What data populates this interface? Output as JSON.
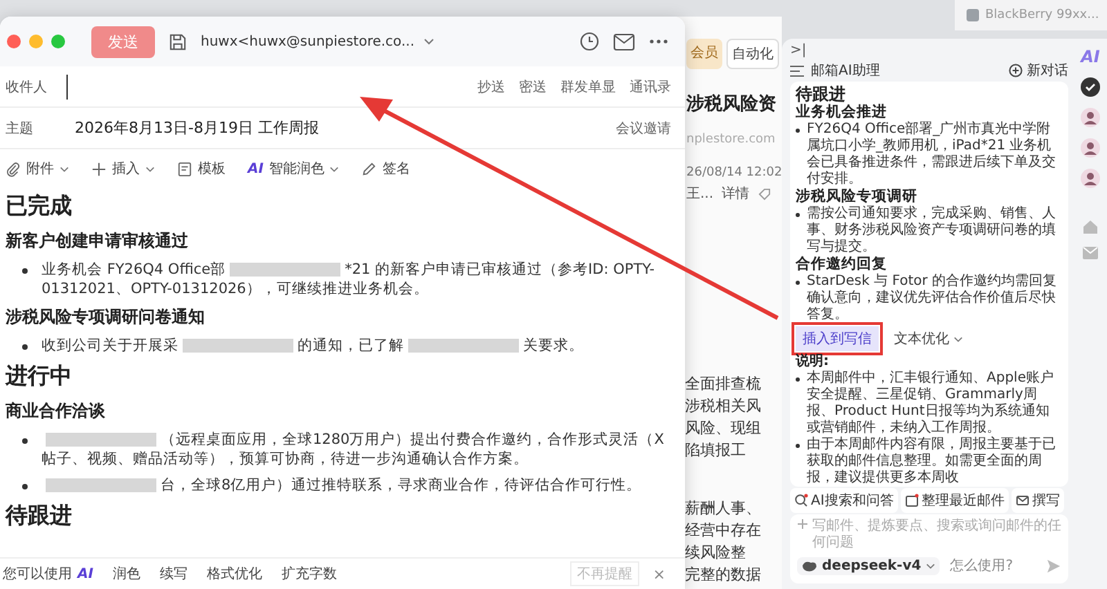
{
  "notification": {
    "label": "BlackBerry 99xx..."
  },
  "background_window": {
    "chips": [
      {
        "label": "会员",
        "kind": "vip"
      },
      {
        "label": "自动化",
        "kind": "plain"
      }
    ],
    "title": "涉税风险资",
    "sender": "nplestore.com",
    "time": "26/08/14 12:02",
    "meta": "王...",
    "detail_link": "详情",
    "paragraphs": [
      [
        "全面排查梳",
        "涉税相关风",
        "风险、现组",
        "陷填报工"
      ],
      [
        "薪酬人事、",
        "经营中存在",
        "续风险整",
        "完整的数据"
      ]
    ]
  },
  "compose": {
    "send_button": "发送",
    "from": "huwx<huwx@sunpiestore.co...",
    "to_label": "收件人",
    "recipient_actions": [
      "抄送",
      "密送",
      "群发单显",
      "通讯录"
    ],
    "subject_label": "主题",
    "subject": "2026年8月13日-8月19日 工作周报",
    "meeting_invite": "会议邀请",
    "toolbar": [
      {
        "kind": "attach",
        "label": "附件",
        "dropdown": true
      },
      {
        "kind": "insert",
        "label": "插入",
        "dropdown": true
      },
      {
        "kind": "template",
        "label": "模板",
        "dropdown": false
      },
      {
        "kind": "ai",
        "icon_text": "AI",
        "label": "智能润色",
        "dropdown": true
      },
      {
        "kind": "sign",
        "label": "签名",
        "dropdown": false
      }
    ],
    "body": [
      {
        "kind": "h1",
        "text": "已完成"
      },
      {
        "kind": "h2",
        "text": "新客户创建申请审核通过"
      },
      {
        "kind": "bullet",
        "parts": [
          {
            "kind": "text",
            "text": "业务机会 FY26Q4 Office部"
          },
          {
            "kind": "redacted"
          },
          {
            "kind": "text",
            "text": "*21 的新客户申请已审核通过（参考ID: OPTY-01312021、OPTY-01312026），可继续推进业务机会。"
          }
        ]
      },
      {
        "kind": "h2",
        "text": "涉税风险专项调研问卷通知"
      },
      {
        "kind": "bullet",
        "parts": [
          {
            "kind": "text",
            "text": "收到公司关于开展采"
          },
          {
            "kind": "redacted"
          },
          {
            "kind": "text",
            "text": "的通知，已了解"
          },
          {
            "kind": "redacted"
          },
          {
            "kind": "text",
            "text": "关要求。"
          }
        ]
      },
      {
        "kind": "h1",
        "text": "进行中"
      },
      {
        "kind": "h2",
        "text": "商业合作洽谈"
      },
      {
        "kind": "bullet",
        "parts": [
          {
            "kind": "redacted"
          },
          {
            "kind": "text",
            "text": "（远程桌面应用，全球1280万用户）提出付费合作邀约，合作形式灵活（X帖子、视频、赠品活动等），预算可协商，待进一步沟通确认合作方案。"
          }
        ]
      },
      {
        "kind": "bullet",
        "parts": [
          {
            "kind": "redacted"
          },
          {
            "kind": "text",
            "text": "台，全球8亿用户）通过推特联系，寻求商业合作，待评估合作可行性。"
          }
        ]
      },
      {
        "kind": "h1",
        "text": "待跟进"
      }
    ],
    "ai_bar": {
      "prefix": "您可以使用",
      "badge": "AI",
      "actions": [
        "润色",
        "续写",
        "格式优化",
        "扩充字数"
      ],
      "dismiss": "不再提醒",
      "close": "×"
    }
  },
  "assistant": {
    "collapse": ">|",
    "title": "邮箱AI助理",
    "new_chat": "新对话",
    "content": [
      {
        "kind": "h1",
        "text": "待跟进"
      },
      {
        "kind": "h2",
        "text": "业务机会推进"
      },
      {
        "kind": "bullet",
        "text": "FY26Q4 Office部署_广州市真光中学附属坑口小学_教师用机，iPad*21 业务机会已具备推进条件，需跟进后续下单及交付安排。"
      },
      {
        "kind": "h2",
        "text": "涉税风险专项调研"
      },
      {
        "kind": "bullet",
        "text": "需按公司通知要求，完成采购、销售、人事、财务涉税风险资产专项调研问卷的填写与提交。"
      },
      {
        "kind": "h2",
        "text": "合作邀约回复"
      },
      {
        "kind": "bullet",
        "text": "StarDesk 与 Fotor 的合作邀约均需回复确认意向，建议优先评估合作价值后尽快答复。"
      }
    ],
    "actions": [
      {
        "label": "插入到写信",
        "selected": true,
        "dropdown": false
      },
      {
        "label": "文本优化",
        "selected": false,
        "dropdown": true
      }
    ],
    "note_title": "说明:",
    "notes": [
      "本周邮件中，汇丰银行通知、Apple账户安全提醒、三星促销、Grammarly周报、Product Hunt日报等均为系统通知或营销邮件，未纳入工作周报。",
      "由于本周邮件内容有限，周报主要基于已获取的邮件信息整理。如需更全面的周报，建议提供更多本周收"
    ],
    "quick_chips": [
      {
        "kind": "search",
        "label": "AI搜索和问答"
      },
      {
        "kind": "organize",
        "label": "整理最近邮件"
      },
      {
        "kind": "write",
        "label": "撰写"
      }
    ],
    "input": {
      "placeholder": "写邮件、提炼要点、搜索或询问邮件的任何问题"
    },
    "model": "deepseek-v4",
    "help": "怎么使用?"
  },
  "rail": {
    "label": "AI"
  }
}
